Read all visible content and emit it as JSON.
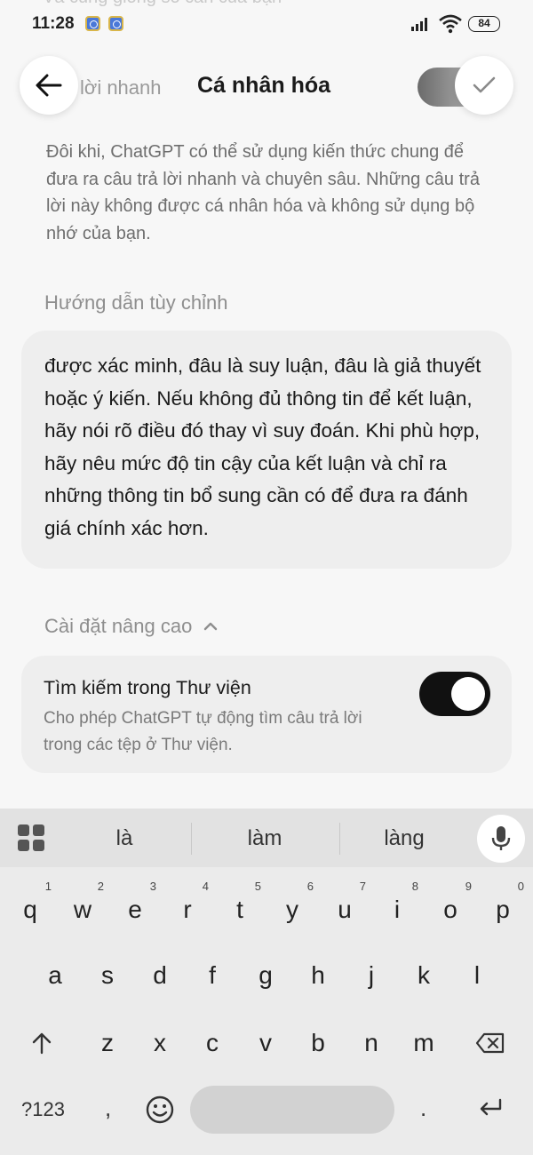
{
  "status_bar": {
    "time": "11:28",
    "battery": "84",
    "ghost_text": "Và cũng giống so cần của bạn"
  },
  "header": {
    "back_icon": "arrow-left-icon",
    "partial_label": "lời nhanh",
    "title": "Cá nhân hóa",
    "confirm_icon": "check-icon"
  },
  "description": "Đôi khi, ChatGPT có thể sử dụng kiến thức chung để đưa ra câu trả lời nhanh và chuyên sâu. Những câu trả lời này không được cá nhân hóa và không sử dụng bộ nhớ của bạn.",
  "custom_instructions": {
    "label": "Hướng dẫn tùy chỉnh",
    "text": "được xác minh, đâu là suy luận, đâu là giả thuyết hoặc ý kiến. Nếu không đủ thông tin để kết luận, hãy nói rõ điều đó thay vì suy đoán. Khi phù hợp, hãy nêu mức độ tin cậy của kết luận và chỉ ra những thông tin bổ sung cần có để đưa ra đánh giá chính xác hơn."
  },
  "advanced": {
    "label": "Cài đặt nâng cao",
    "library_search": {
      "title": "Tìm kiếm trong Thư viện",
      "description": "Cho phép ChatGPT tự động tìm câu trả lời trong các tệp ở Thư viện.",
      "enabled": true
    }
  },
  "keyboard": {
    "suggestions": [
      "là",
      "làm",
      "làng"
    ],
    "row1": [
      {
        "key": "q",
        "num": "1"
      },
      {
        "key": "w",
        "num": "2"
      },
      {
        "key": "e",
        "num": "3"
      },
      {
        "key": "r",
        "num": "4"
      },
      {
        "key": "t",
        "num": "5"
      },
      {
        "key": "y",
        "num": "6"
      },
      {
        "key": "u",
        "num": "7"
      },
      {
        "key": "i",
        "num": "8"
      },
      {
        "key": "o",
        "num": "9"
      },
      {
        "key": "p",
        "num": "0"
      }
    ],
    "row2": [
      "a",
      "s",
      "d",
      "f",
      "g",
      "h",
      "j",
      "k",
      "l"
    ],
    "row3": [
      "z",
      "x",
      "c",
      "v",
      "b",
      "n",
      "m"
    ],
    "symbols_label": "?123",
    "comma": ",",
    "period": "."
  }
}
